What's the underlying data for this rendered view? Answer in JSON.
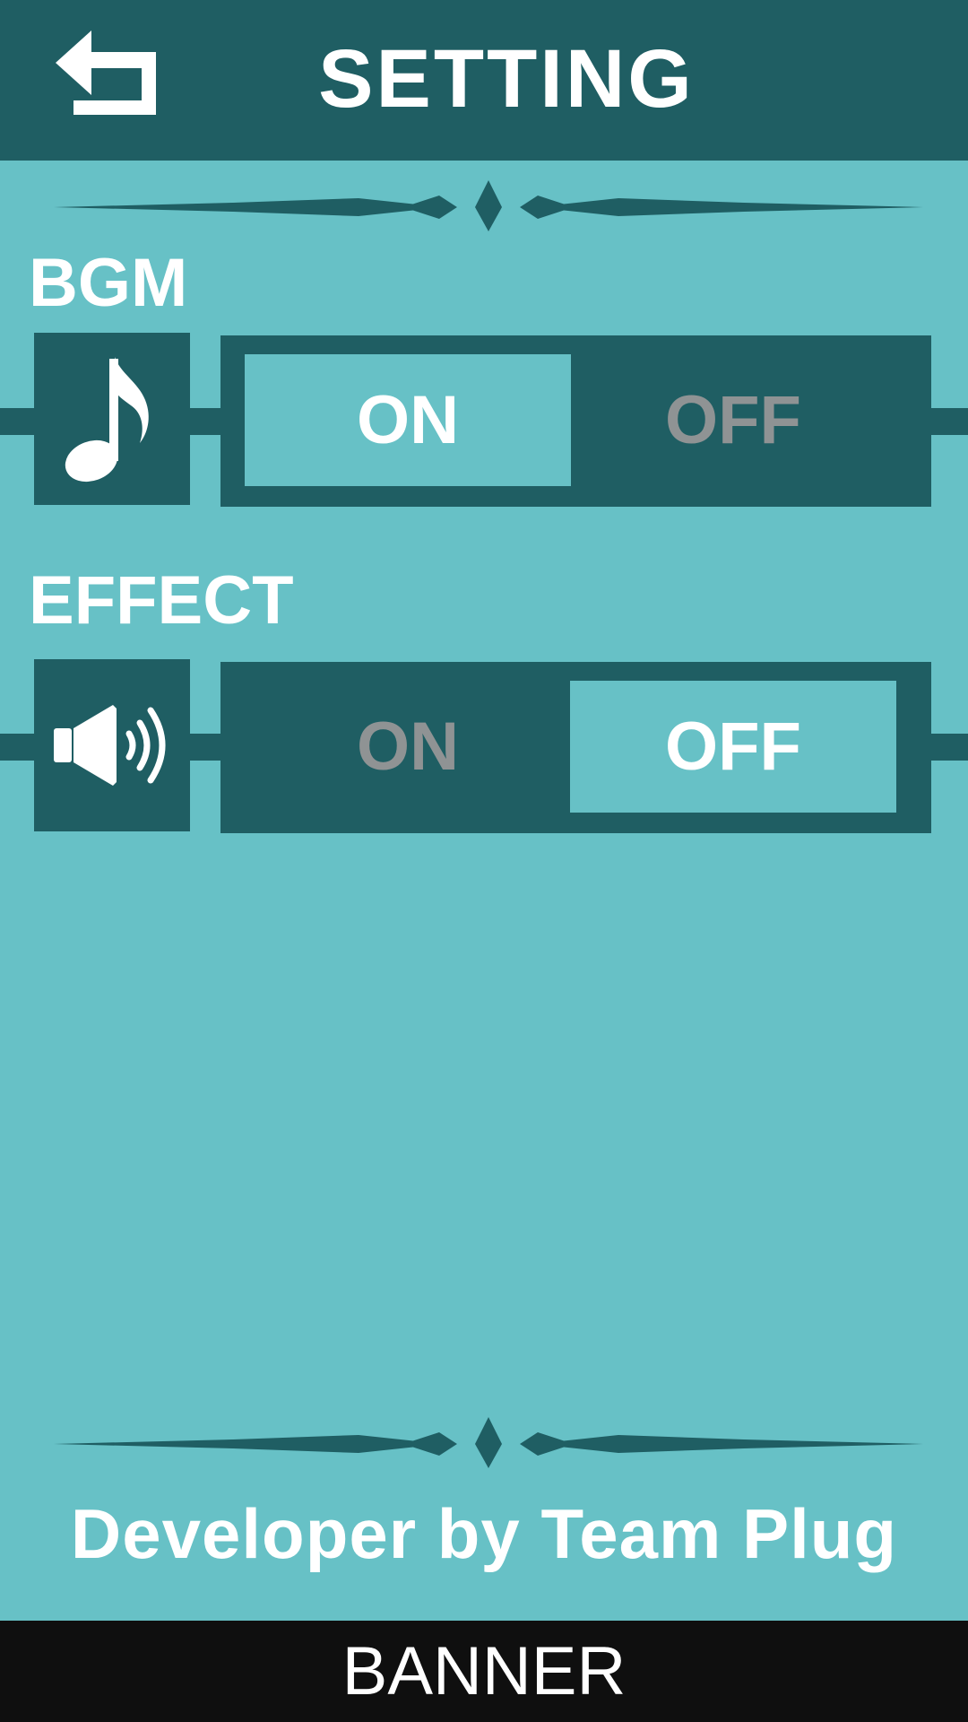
{
  "header": {
    "title": "SETTING",
    "back_icon": "back-arrow-icon"
  },
  "bgm": {
    "label": "BGM",
    "icon": "music-note-icon",
    "on_label": "ON",
    "off_label": "OFF",
    "selected": "ON"
  },
  "effect": {
    "label": "EFFECT",
    "icon": "speaker-icon",
    "on_label": "ON",
    "off_label": "OFF",
    "selected": "OFF"
  },
  "footer": {
    "credit": "Developer by Team Plug",
    "banner": "BANNER"
  },
  "colors": {
    "background": "#67c1c6",
    "dark_teal": "#1f5e63",
    "inactive_text": "#8f9394",
    "banner_bg": "#0f0f0f"
  }
}
